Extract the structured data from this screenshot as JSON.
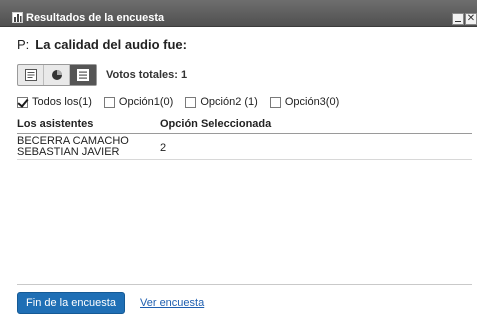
{
  "window": {
    "title": "Resultados de la encuesta",
    "icon": "bar-chart-icon"
  },
  "question": {
    "prefix": "P:",
    "text": "La calidad del audio fue:"
  },
  "view_toggle": {
    "options": [
      "list-view-icon",
      "pie-chart-icon",
      "table-view-icon"
    ],
    "active": "table-view-icon"
  },
  "votes_label": "Votos totales: 1",
  "filters": [
    {
      "label": "Todos los(1)",
      "checked": true
    },
    {
      "label": "Opción1(0)",
      "checked": false
    },
    {
      "label": "Opción2 (1)",
      "checked": false
    },
    {
      "label": "Opción3(0)",
      "checked": false
    }
  ],
  "table": {
    "headers": [
      "Los asistentes",
      "Opción Seleccionada"
    ],
    "rows": [
      {
        "name": "BECERRA CAMACHO SEBASTIAN JAVIER",
        "option": "2"
      }
    ]
  },
  "footer": {
    "end_button": "Fin de la encuesta",
    "view_link": "Ver encuesta"
  },
  "colors": {
    "titlebar": "#5a5a5a",
    "primary_button": "#1f6fb5",
    "link": "#1f5fb0"
  }
}
